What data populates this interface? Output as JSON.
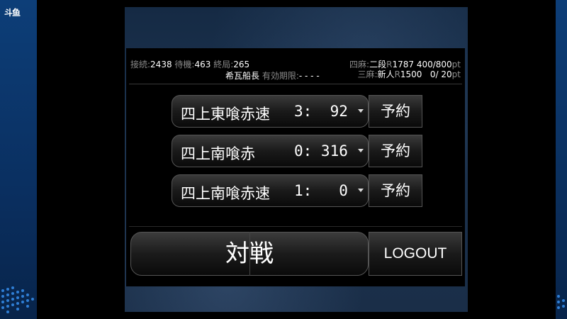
{
  "overlay": {
    "logo_text": "斗鱼"
  },
  "stats": {
    "connections_label": "接続:",
    "connections": "2438",
    "waiting_label": "待機:",
    "waiting": "463",
    "finished_label": "終局:",
    "finished": "265"
  },
  "user": {
    "name": "希瓦船長",
    "expiry_label": "有効期限:",
    "expiry": "- - - -"
  },
  "ranks": [
    {
      "mode_label": "四麻:",
      "dan": "二段",
      "r_label": "R",
      "rating": "1787",
      "points": "400/800",
      "unit": "pt"
    },
    {
      "mode_label": "三麻:",
      "dan": "新人",
      "r_label": "R",
      "rating": "1500",
      "points": "  0/ 20",
      "unit": "pt"
    }
  ],
  "games": [
    {
      "label": "四上東喰赤速",
      "count": "3:  92",
      "reserve": "予約"
    },
    {
      "label": "四上南喰赤",
      "count": "0: 316",
      "reserve": "予約"
    },
    {
      "label": "四上南喰赤速",
      "count": "1:   0",
      "reserve": "予約"
    }
  ],
  "actions": {
    "battle": "対戦",
    "logout": "LOGOUT"
  }
}
